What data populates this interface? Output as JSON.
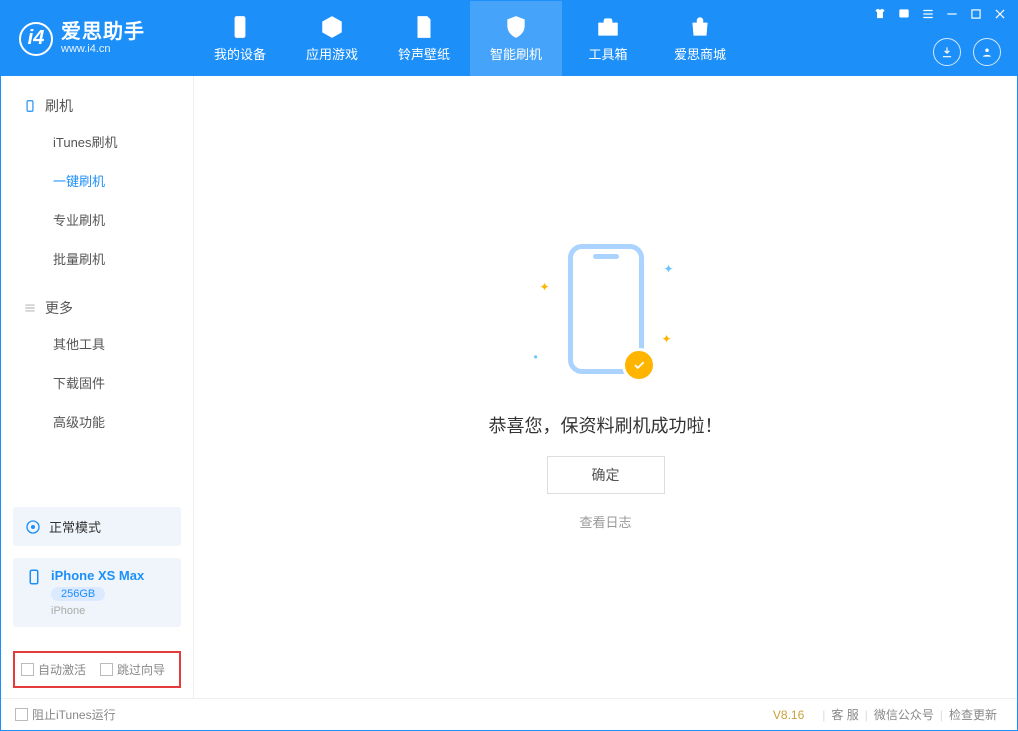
{
  "header": {
    "app_name": "爱思助手",
    "app_site": "www.i4.cn",
    "nav": [
      "我的设备",
      "应用游戏",
      "铃声壁纸",
      "智能刷机",
      "工具箱",
      "爱思商城"
    ],
    "active_nav_index": 3
  },
  "sidebar": {
    "group1_title": "刷机",
    "group1_items": [
      "iTunes刷机",
      "一键刷机",
      "专业刷机",
      "批量刷机"
    ],
    "group1_active_index": 1,
    "group2_title": "更多",
    "group2_items": [
      "其他工具",
      "下载固件",
      "高级功能"
    ],
    "mode_label": "正常模式",
    "device": {
      "name": "iPhone XS Max",
      "capacity": "256GB",
      "subtitle": "iPhone"
    },
    "checks": {
      "auto_activate": "自动激活",
      "skip_guide": "跳过向导"
    }
  },
  "main": {
    "success_text": "恭喜您，保资料刷机成功啦！",
    "ok_button": "确定",
    "view_log": "查看日志"
  },
  "footer": {
    "block_itunes": "阻止iTunes运行",
    "version": "V8.16",
    "links": [
      "客  服",
      "微信公众号",
      "检查更新"
    ]
  }
}
